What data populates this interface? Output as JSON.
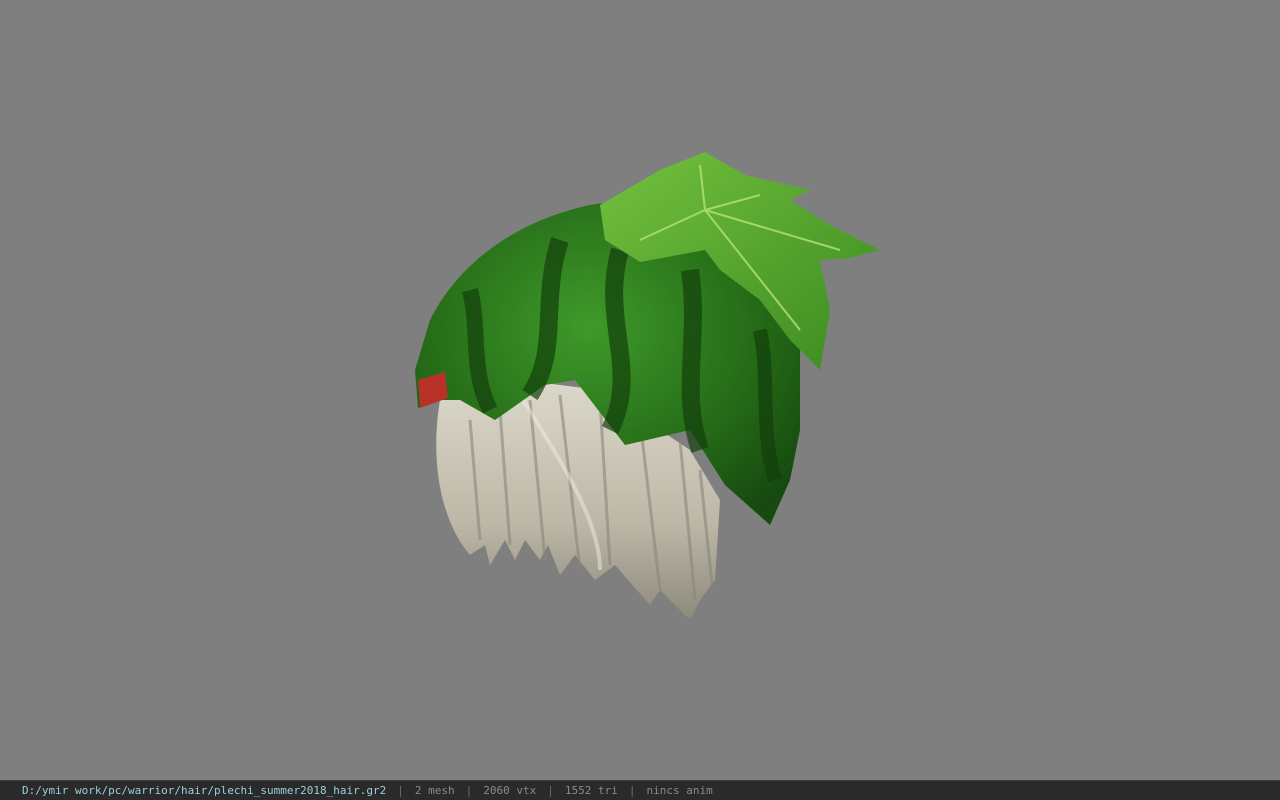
{
  "viewport": {
    "background": "#7f7f7f",
    "model_name": "watermelon-hair-model"
  },
  "status_bar": {
    "file_path": "D:/ymir work/pc/warrior/hair/plechi_summer2018_hair.gr2",
    "separator": "|",
    "mesh": "2 mesh",
    "vertices": "2060 vtx",
    "triangles": "1552 tri",
    "anim": "nincs anim"
  },
  "colors": {
    "rind_dark": "#1f5a14",
    "rind_light": "#3d8a28",
    "leaf": "#4fa02a",
    "hair": "#c9c4b6",
    "status_bg": "#2a2a2a",
    "path_text": "#9ad0d8"
  }
}
